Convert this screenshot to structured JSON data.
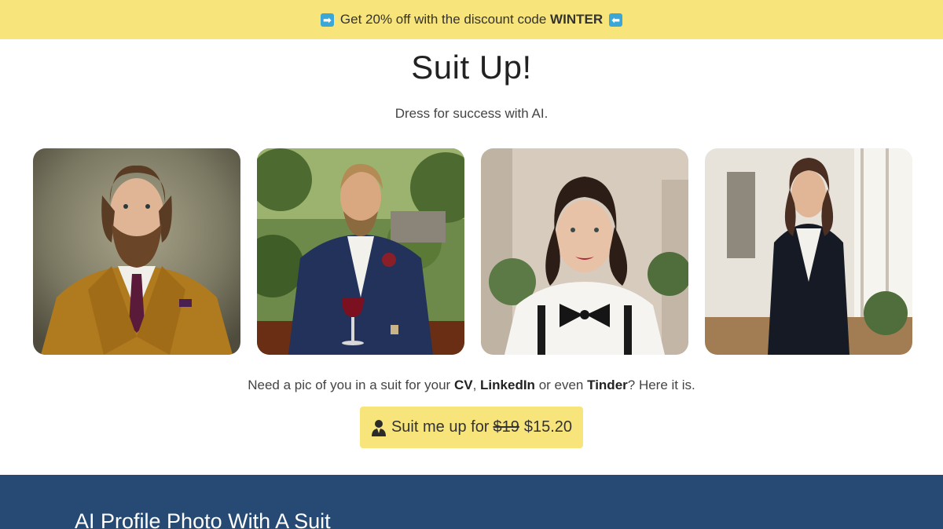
{
  "banner": {
    "prefix": "Get 20% off with the discount code",
    "code": "WINTER",
    "left_icon": "right-arrow-icon",
    "right_icon": "left-arrow-icon"
  },
  "hero": {
    "title": "Suit Up!",
    "subtitle": "Dress for success with AI."
  },
  "gallery": [
    "man-mustard-suit",
    "man-navy-suit-wine",
    "woman-bowtie-suspenders",
    "woman-black-blazer"
  ],
  "pitch": {
    "lead": "Need a pic of you in a suit for your",
    "cv": "CV",
    "comma": ",",
    "linkedin": "LinkedIn",
    "or_even": "or even",
    "tinder": "Tinder",
    "tail": "? Here it is."
  },
  "cta": {
    "icon": "person-icon",
    "label": "Suit me up for",
    "old_price": "$19",
    "new_price": "$15.20"
  },
  "section": {
    "title": "AI Profile Photo With A Suit"
  },
  "colors": {
    "banner_bg": "#f7e47b",
    "button_bg": "#f7e47b",
    "section_bg": "#264a73",
    "arrow_icon_bg": "#3aa7d8"
  }
}
